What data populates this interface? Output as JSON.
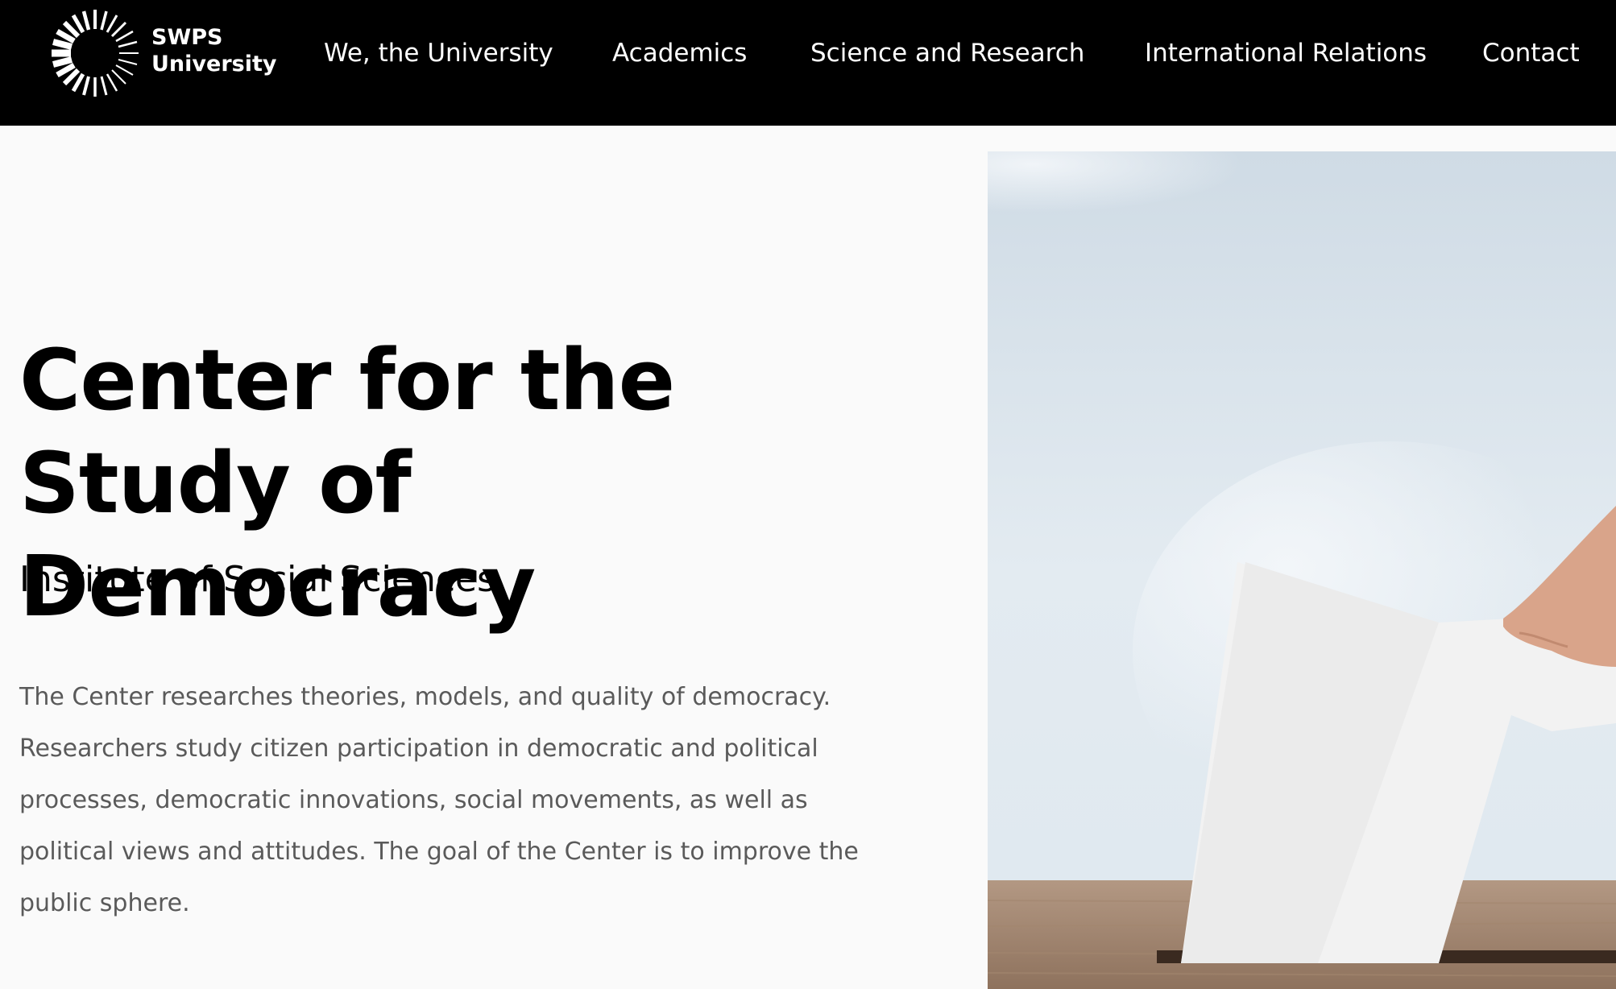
{
  "header": {
    "logo_line1": "SWPS",
    "logo_line2": "University",
    "nav": [
      {
        "label": "We, the University"
      },
      {
        "label": "Academics"
      },
      {
        "label": "Science and Research"
      },
      {
        "label": "International Relations"
      },
      {
        "label": "Contact"
      }
    ]
  },
  "hero": {
    "title": "Center for the Study of Democracy",
    "subtitle": "Institute of Social Sciences",
    "description": "The Center researches theories, models, and quality of democracy. Researchers study citizen participation in democratic and political processes, democratic innovations, social movements, as well as political views and attitudes. The goal of the Center is to improve the public sphere.",
    "image_icon": "ballot-box-illustration"
  },
  "colors": {
    "header_bg": "#000000",
    "page_bg": "#fafafa",
    "text_primary": "#000000",
    "text_secondary": "#5a5a5a"
  }
}
